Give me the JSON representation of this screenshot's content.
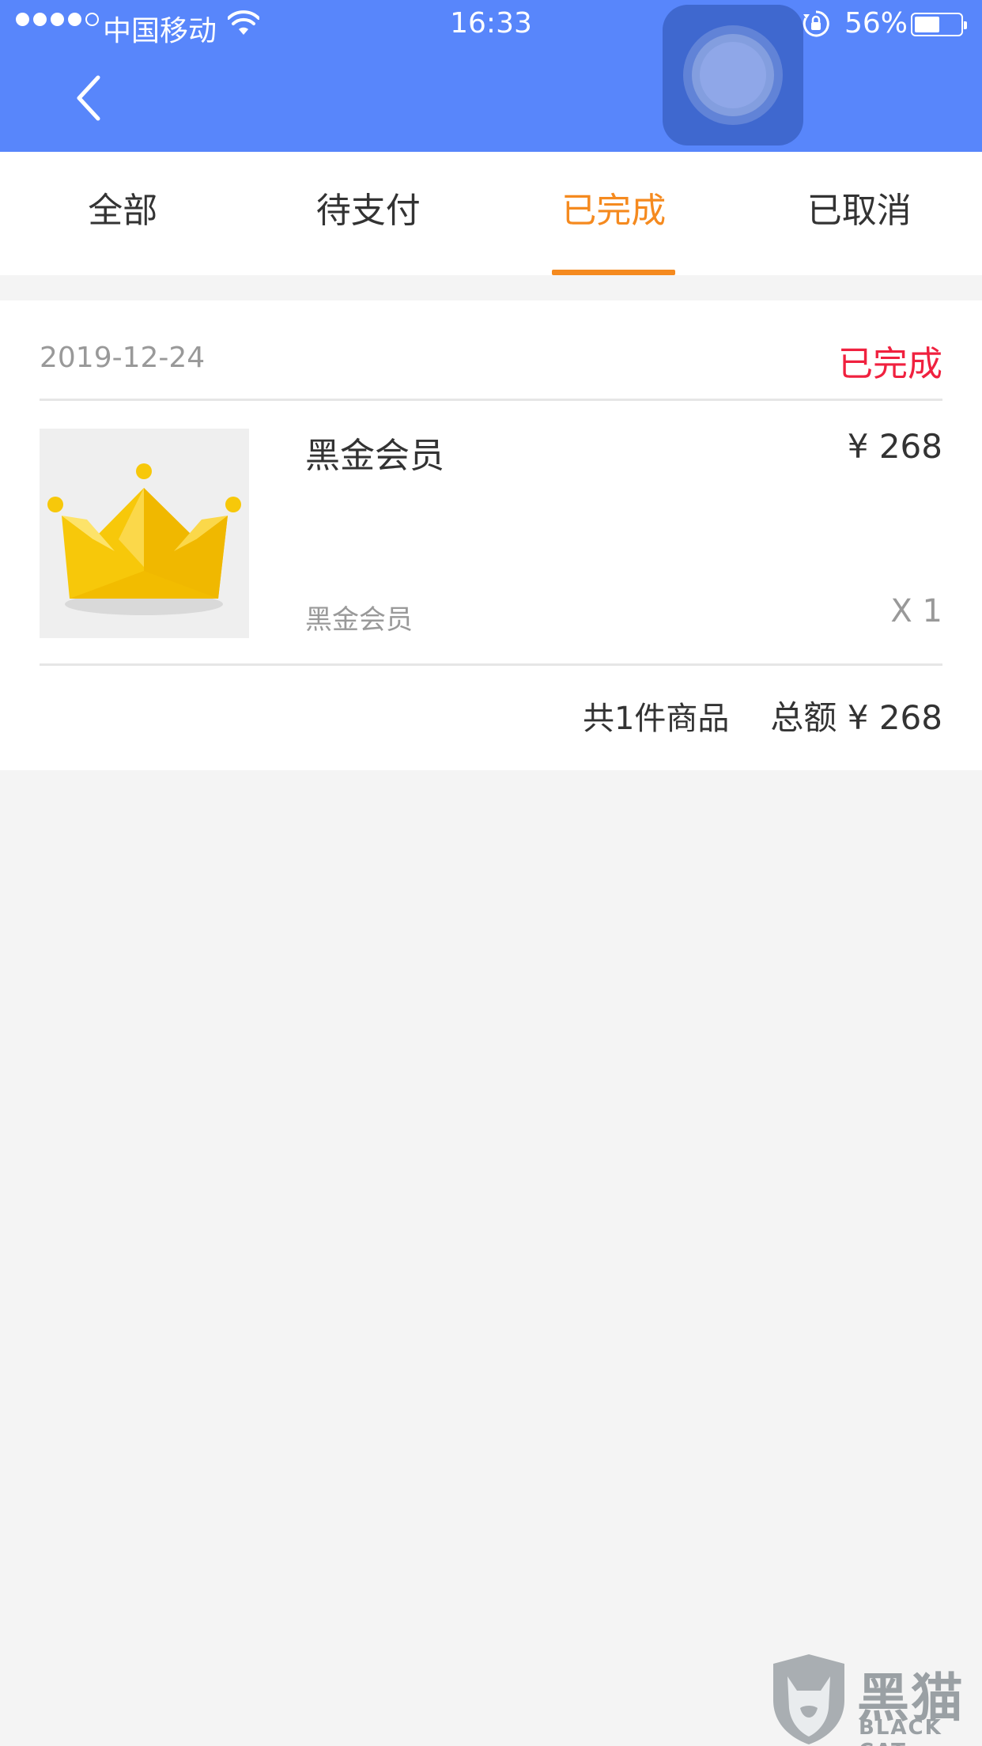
{
  "status_bar": {
    "carrier": "中国移动",
    "time": "16:33",
    "battery_percent": "56%",
    "battery_level": 0.56,
    "signal_bars_filled": 4,
    "signal_bars_total": 5,
    "icons": [
      "signal-dots-icon",
      "wifi-icon",
      "rotation-lock-icon",
      "battery-icon"
    ]
  },
  "header": {
    "back_icon": "chevron-left-icon",
    "background_color": "#5886fb",
    "assistive_touch_icon": "assistive-touch-icon"
  },
  "tabs": [
    {
      "label": "全部",
      "active": false
    },
    {
      "label": "待支付",
      "active": false
    },
    {
      "label": "已完成",
      "active": true
    },
    {
      "label": "已取消",
      "active": false
    }
  ],
  "accent_color": "#f58a1f",
  "order": {
    "date": "2019-12-24",
    "status": "已完成",
    "status_color": "#f0213f",
    "product": {
      "image_icon": "crown-icon",
      "name": "黑金会员",
      "subtitle": "黑金会员",
      "price": "¥ 268",
      "quantity": "X 1"
    },
    "summary": {
      "count": "共1件商品",
      "total": "总额 ¥ 268"
    }
  },
  "watermark": {
    "title": "黑猫",
    "subtitle": "BLACK CAT"
  }
}
